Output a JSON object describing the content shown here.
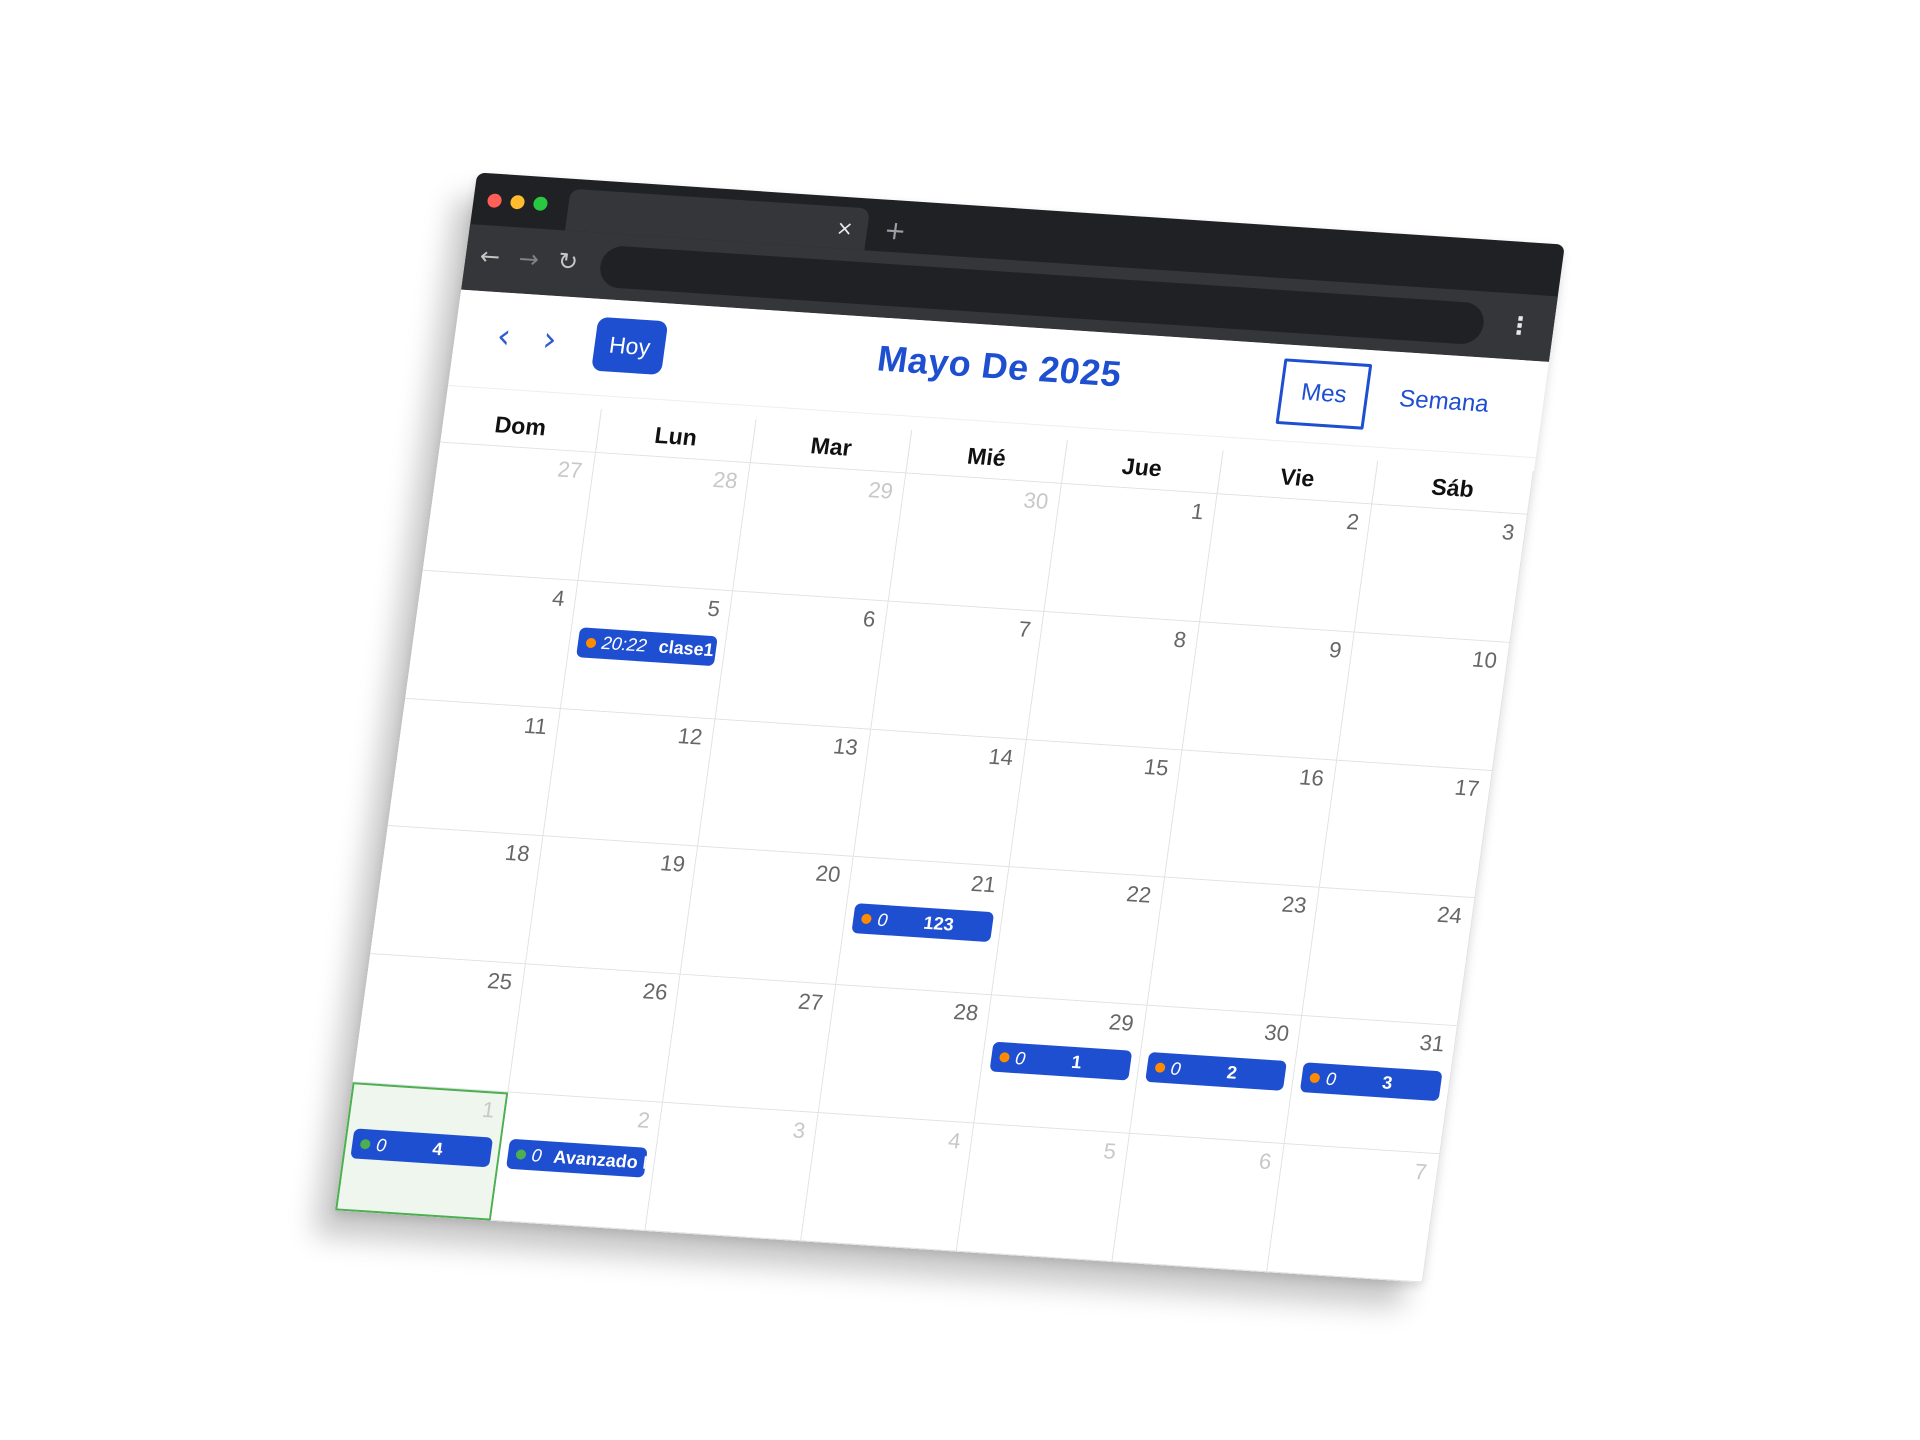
{
  "browser": {
    "tab_close_glyph": "×",
    "new_tab_glyph": "+",
    "back_glyph": "←",
    "forward_glyph": "→",
    "reload_glyph": "↻",
    "menu_glyph": "⋮"
  },
  "calendar": {
    "prev_glyph": "‹",
    "next_glyph": "›",
    "today_label": "Hoy",
    "title": "Mayo De 2025",
    "views": [
      "Mes",
      "Semana"
    ],
    "active_view": "Mes",
    "weekdays": [
      "Dom",
      "Lun",
      "Mar",
      "Mié",
      "Jue",
      "Vie",
      "Sáb"
    ],
    "weeks": [
      [
        {
          "n": "27",
          "other": true
        },
        {
          "n": "28",
          "other": true
        },
        {
          "n": "29",
          "other": true
        },
        {
          "n": "30",
          "other": true
        },
        {
          "n": "1"
        },
        {
          "n": "2"
        },
        {
          "n": "3"
        }
      ],
      [
        {
          "n": "4"
        },
        {
          "n": "5"
        },
        {
          "n": "6"
        },
        {
          "n": "7"
        },
        {
          "n": "8"
        },
        {
          "n": "9"
        },
        {
          "n": "10"
        }
      ],
      [
        {
          "n": "11"
        },
        {
          "n": "12"
        },
        {
          "n": "13"
        },
        {
          "n": "14"
        },
        {
          "n": "15"
        },
        {
          "n": "16"
        },
        {
          "n": "17"
        }
      ],
      [
        {
          "n": "18"
        },
        {
          "n": "19"
        },
        {
          "n": "20"
        },
        {
          "n": "21"
        },
        {
          "n": "22"
        },
        {
          "n": "23"
        },
        {
          "n": "24"
        }
      ],
      [
        {
          "n": "25"
        },
        {
          "n": "26"
        },
        {
          "n": "27"
        },
        {
          "n": "28"
        },
        {
          "n": "29"
        },
        {
          "n": "30"
        },
        {
          "n": "31"
        }
      ],
      [
        {
          "n": "1",
          "other": true,
          "today": true
        },
        {
          "n": "2",
          "other": true
        },
        {
          "n": "3",
          "other": true
        },
        {
          "n": "4",
          "other": true
        },
        {
          "n": "5",
          "other": true
        },
        {
          "n": "6",
          "other": true
        },
        {
          "n": "7",
          "other": true
        }
      ]
    ],
    "events": [
      {
        "week": 1,
        "day": 1,
        "dot": "#ff8c00",
        "time": "20:22",
        "title": "clase1",
        "title_center": false
      },
      {
        "week": 3,
        "day": 3,
        "dot": "#ff8c00",
        "time": "0",
        "title": "123",
        "title_center": true
      },
      {
        "week": 4,
        "day": 4,
        "dot": "#ff8c00",
        "time": "0",
        "title": "1",
        "title_center": true
      },
      {
        "week": 4,
        "day": 5,
        "dot": "#ff8c00",
        "time": "0",
        "title": "2",
        "title_center": true
      },
      {
        "week": 4,
        "day": 6,
        "dot": "#ff8c00",
        "time": "0",
        "title": "3",
        "title_center": true
      },
      {
        "week": 5,
        "day": 0,
        "dot": "#4caf50",
        "time": "0",
        "title": "4",
        "title_center": true
      },
      {
        "week": 5,
        "day": 1,
        "dot": "#4caf50",
        "time": "0",
        "title": "Avanzado B",
        "title_center": false
      }
    ]
  },
  "colors": {
    "primary": "#1f4fd1",
    "chrome_dark": "#202124",
    "today_bg": "#eef6ee",
    "today_border": "#4caf50",
    "event_dot_orange": "#ff8c00",
    "event_dot_green": "#4caf50"
  }
}
